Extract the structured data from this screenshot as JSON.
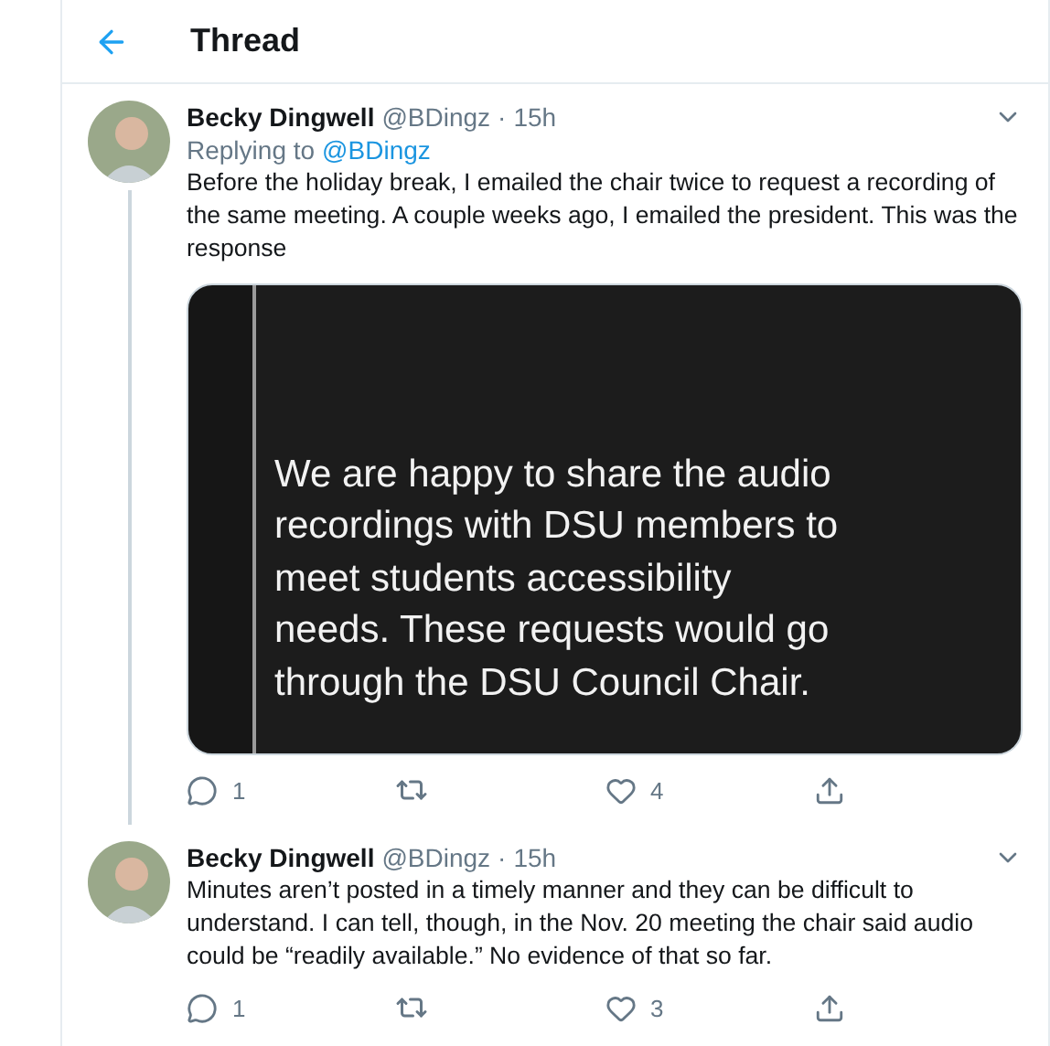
{
  "header": {
    "title": "Thread"
  },
  "tweets": [
    {
      "name": "Becky Dingwell",
      "handle": "@BDingz",
      "separator": "·",
      "time": "15h",
      "replying_label": "Replying to",
      "replying_to": "@BDingz",
      "text": "Before the holiday break, I emailed the chair twice to request a recording of the same meeting. A couple weeks ago, I emailed the president. This was the response",
      "image_text": "We are happy to share the audio recordings with DSU members to meet students accessibility needs. These requests would go through the DSU Council Chair.",
      "replies": "1",
      "likes": "4"
    },
    {
      "name": "Becky Dingwell",
      "handle": "@BDingz",
      "separator": "·",
      "time": "15h",
      "text": "Minutes aren’t posted in a timely manner and they can be difficult to understand. I can tell, though, in the Nov. 20 meeting the chair said audio could be “readily available.” No evidence of that so far.",
      "replies": "1",
      "likes": "3"
    }
  ]
}
